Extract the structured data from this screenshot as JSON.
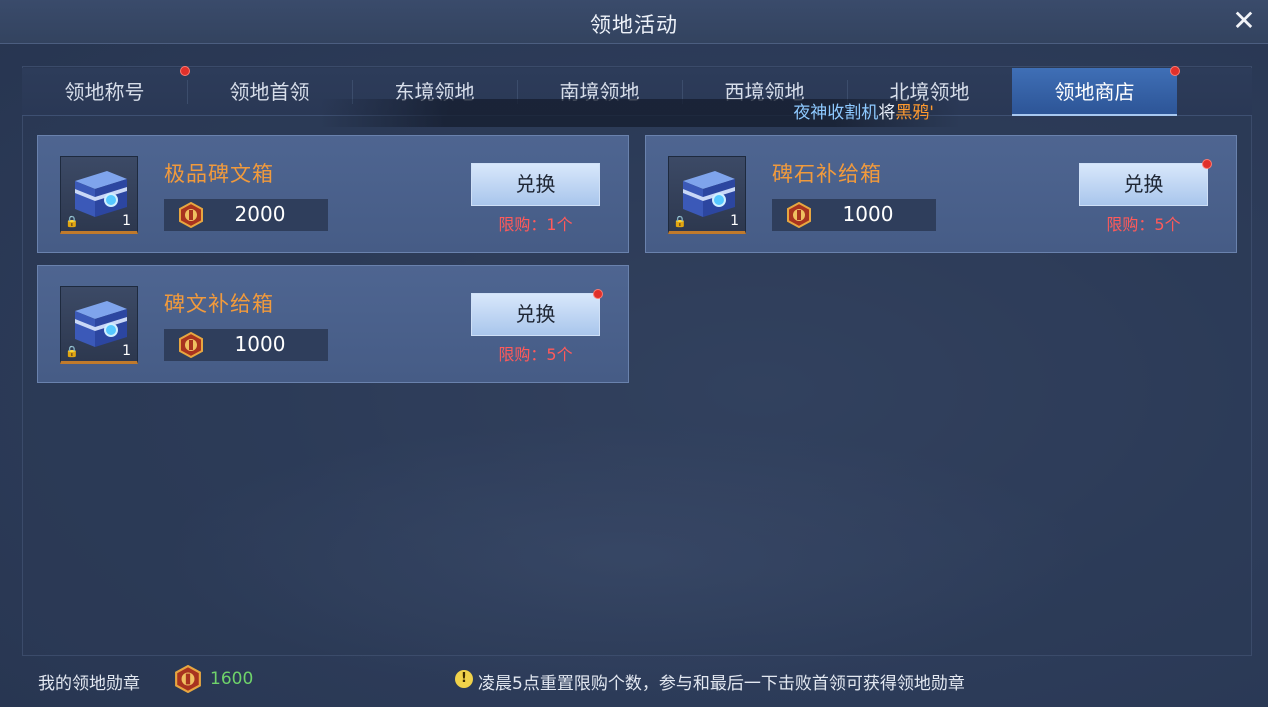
{
  "window": {
    "title": "领地活动"
  },
  "tabs": [
    {
      "label": "领地称号",
      "active": false,
      "badge": true
    },
    {
      "label": "领地首领",
      "active": false,
      "badge": false
    },
    {
      "label": "东境领地",
      "active": false,
      "badge": false
    },
    {
      "label": "南境领地",
      "active": false,
      "badge": false
    },
    {
      "label": "西境领地",
      "active": false,
      "badge": false
    },
    {
      "label": "北境领地",
      "active": false,
      "badge": false
    },
    {
      "label": "领地商店",
      "active": true,
      "badge": true
    }
  ],
  "marquee": {
    "part1": "夜神收割机",
    "part2": "将",
    "part3": "黑鸦'"
  },
  "shop_items": [
    {
      "name": "极品碑文箱",
      "quantity": "1",
      "price": "2000",
      "button": "兑换",
      "limit": "限购：1个",
      "badge": false
    },
    {
      "name": "碑石补给箱",
      "quantity": "1",
      "price": "1000",
      "button": "兑换",
      "limit": "限购：5个",
      "badge": true
    },
    {
      "name": "碑文补给箱",
      "quantity": "1",
      "price": "1000",
      "button": "兑换",
      "limit": "限购：5个",
      "badge": true
    }
  ],
  "footer": {
    "label": "我的领地勋章",
    "count": "1600",
    "tip": "凌晨5点重置限购个数，参与和最后一下击败首领可获得领地勋章"
  },
  "icons": {
    "close": "close-icon",
    "medal": "medal-icon",
    "chest": "chest-icon",
    "lock": "lock-icon",
    "info": "info-icon"
  },
  "colors": {
    "accent_orange": "#f19a3c",
    "limit_red": "#ff5a5a",
    "count_green": "#6fd36a",
    "active_tab": "#3f6fb6",
    "badge_red": "#e0302b"
  }
}
